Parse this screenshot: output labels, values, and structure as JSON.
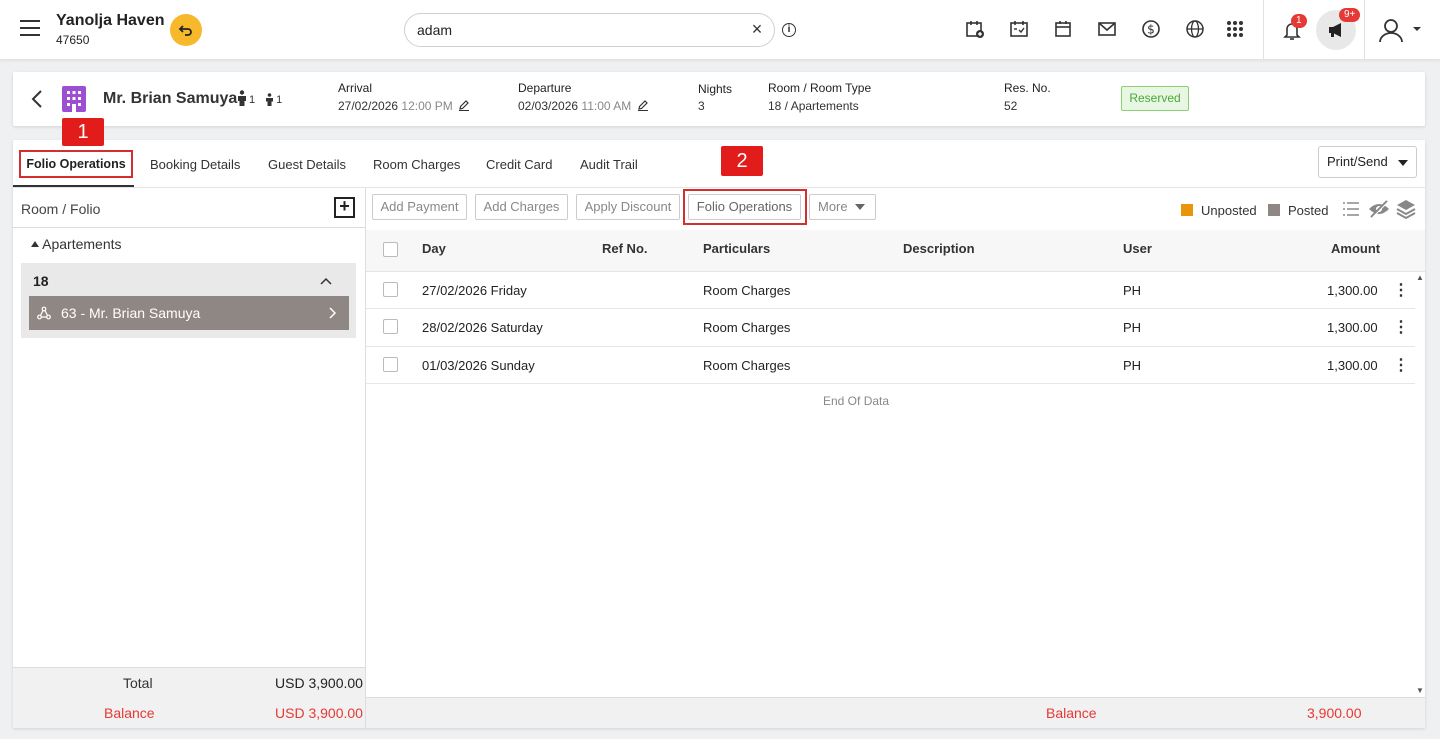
{
  "topbar": {
    "hotel_name": "Yanolja Haven",
    "hotel_id": "47650",
    "search_value": "adam",
    "notification_count": "1",
    "announcement_count": "9+"
  },
  "reservation": {
    "guest_name": "Mr. Brian Samuya",
    "adults": "1",
    "children": "1",
    "arrival_label": "Arrival",
    "arrival_date": "27/02/2026",
    "arrival_time": "12:00 PM",
    "departure_label": "Departure",
    "departure_date": "02/03/2026",
    "departure_time": "11:00 AM",
    "nights_label": "Nights",
    "nights": "3",
    "room_label": "Room / Room Type",
    "room_value": "18 / Apartements",
    "resno_label": "Res. No.",
    "resno": "52",
    "status": "Reserved"
  },
  "tabs": [
    "Folio Operations",
    "Booking Details",
    "Guest Details",
    "Room Charges",
    "Credit Card",
    "Audit Trail"
  ],
  "annotations": [
    "1",
    "2"
  ],
  "print_send": "Print/Send",
  "left": {
    "header": "Room / Folio",
    "room_type": "Apartements",
    "room_number": "18",
    "folio_guest": "63 - Mr. Brian Samuya",
    "total_label": "Total",
    "total_value": "USD 3,900.00",
    "balance_label": "Balance",
    "balance_value": "USD 3,900.00"
  },
  "toolbar": {
    "add_payment": "Add Payment",
    "add_charges": "Add Charges",
    "apply_discount": "Apply Discount",
    "folio_operations": "Folio Operations",
    "more": "More",
    "legend_unposted": "Unposted",
    "legend_posted": "Posted"
  },
  "table": {
    "columns": [
      "Day",
      "Ref No.",
      "Particulars",
      "Description",
      "User",
      "Amount"
    ],
    "rows": [
      {
        "day": "27/02/2026 Friday",
        "ref": "",
        "particulars": "Room Charges",
        "description": "",
        "user": "PH",
        "amount": "1,300.00"
      },
      {
        "day": "28/02/2026 Saturday",
        "ref": "",
        "particulars": "Room Charges",
        "description": "",
        "user": "PH",
        "amount": "1,300.00"
      },
      {
        "day": "01/03/2026 Sunday",
        "ref": "",
        "particulars": "Room Charges",
        "description": "",
        "user": "PH",
        "amount": "1,300.00"
      }
    ],
    "end_of_data": "End Of Data",
    "balance_label": "Balance",
    "balance_value": "3,900.00"
  },
  "colors": {
    "unposted": "#e8950c",
    "posted": "#8f8783",
    "reserved_bg": "#e8f7e3",
    "annotation_red": "#e21b1b"
  }
}
